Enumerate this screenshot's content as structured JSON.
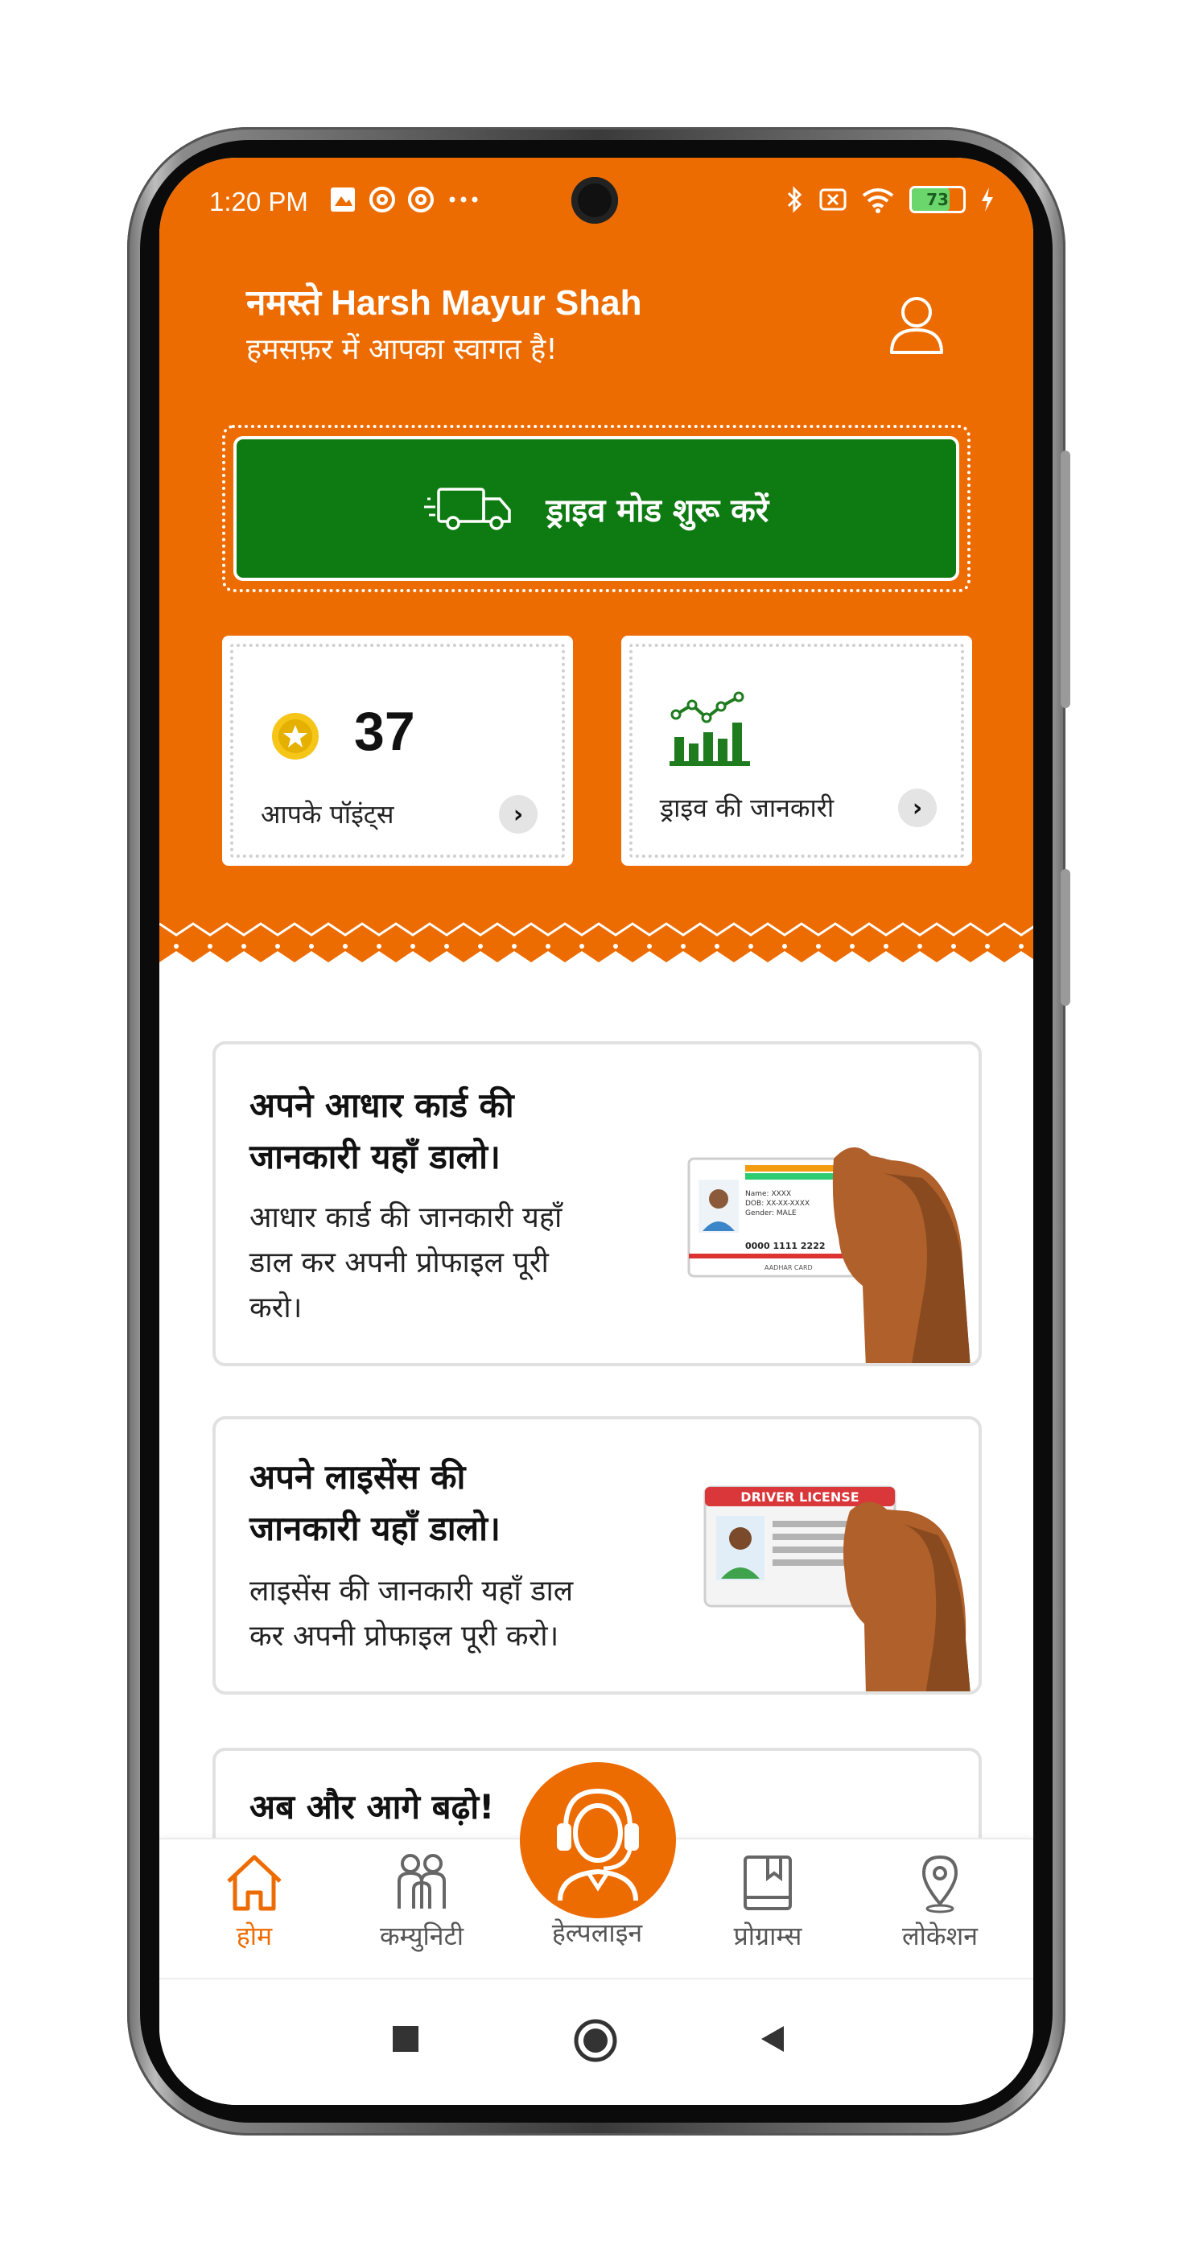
{
  "status_bar": {
    "time": "1:20 PM",
    "battery": "73",
    "icons_left": [
      "gallery-icon",
      "at-icon",
      "at-icon",
      "more-dots-icon"
    ],
    "icons_right": [
      "bluetooth-icon",
      "no-sim-icon",
      "wifi-icon",
      "battery-icon",
      "charging-icon"
    ]
  },
  "header": {
    "greeting": "नमस्ते Harsh Mayur Shah",
    "welcome": "हमसफ़र में आपका स्वागत है!"
  },
  "drive_button": {
    "label": "ड्राइव मोड शुरू करें"
  },
  "points_card": {
    "value": "37",
    "label": "आपके पॉइंट्स"
  },
  "drive_info_card": {
    "label": "ड्राइव की जानकारी"
  },
  "cards": [
    {
      "title_line1": "अपने आधार कार्ड की",
      "title_line2": "जानकारी यहाँ डालो।",
      "desc_line1": "आधार कार्ड की जानकारी यहाँ",
      "desc_line2": "डाल कर अपनी प्रोफाइल पूरी",
      "desc_line3": "करो।",
      "image_lines": [
        "Name: XXXX",
        "DOB: XX-XX-XXXX",
        "Gender: MALE",
        "0000 1111 2222",
        "AADHAR CARD"
      ]
    },
    {
      "title_line1": "अपने लाइसेंस की",
      "title_line2": "जानकारी यहाँ डालो।",
      "desc_line1": "लाइसेंस की जानकारी यहाँ डाल",
      "desc_line2": "कर अपनी प्रोफाइल पूरी करो।",
      "image_title": "DRIVER LICENSE"
    },
    {
      "title_line1": "अब और आगे बढ़ो!"
    }
  ],
  "bottom_nav": {
    "items": [
      {
        "label": "होम",
        "icon": "home-icon",
        "active": true
      },
      {
        "label": "कम्युनिटी",
        "icon": "community-icon",
        "active": false
      },
      {
        "label": "हेल्पलाइन",
        "icon": "headset-icon",
        "active": false
      },
      {
        "label": "प्रोग्राम्स",
        "icon": "book-icon",
        "active": false
      },
      {
        "label": "लोकेशन",
        "icon": "location-pin-icon",
        "active": false
      }
    ]
  },
  "colors": {
    "primary_orange": "#ed6c02",
    "drive_green": "#0e7a12",
    "coin_yellow": "#f5c518"
  }
}
